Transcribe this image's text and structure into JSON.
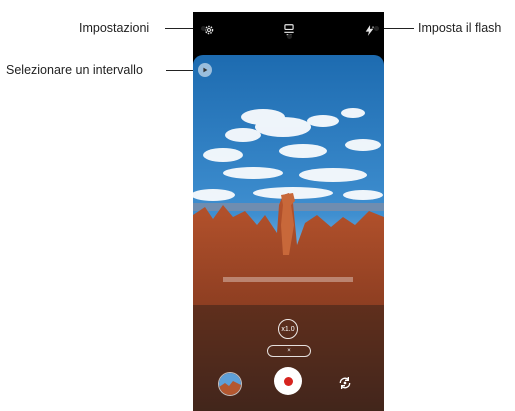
{
  "callouts": {
    "settings": "Impostazioni",
    "interval": "Selezionare un intervallo",
    "flash": "Imposta il flash"
  },
  "topbar": {
    "settings_icon": "gear-icon",
    "interval_icon": "interval-timer-icon",
    "flash_icon": "flash-auto-icon"
  },
  "controls": {
    "zoom_label": "x1.0",
    "pill_label": "×",
    "gallery_icon": "gallery-thumbnail",
    "shutter_icon": "record-button",
    "switch_icon": "switch-camera-icon"
  },
  "colors": {
    "record": "#d6241f"
  }
}
